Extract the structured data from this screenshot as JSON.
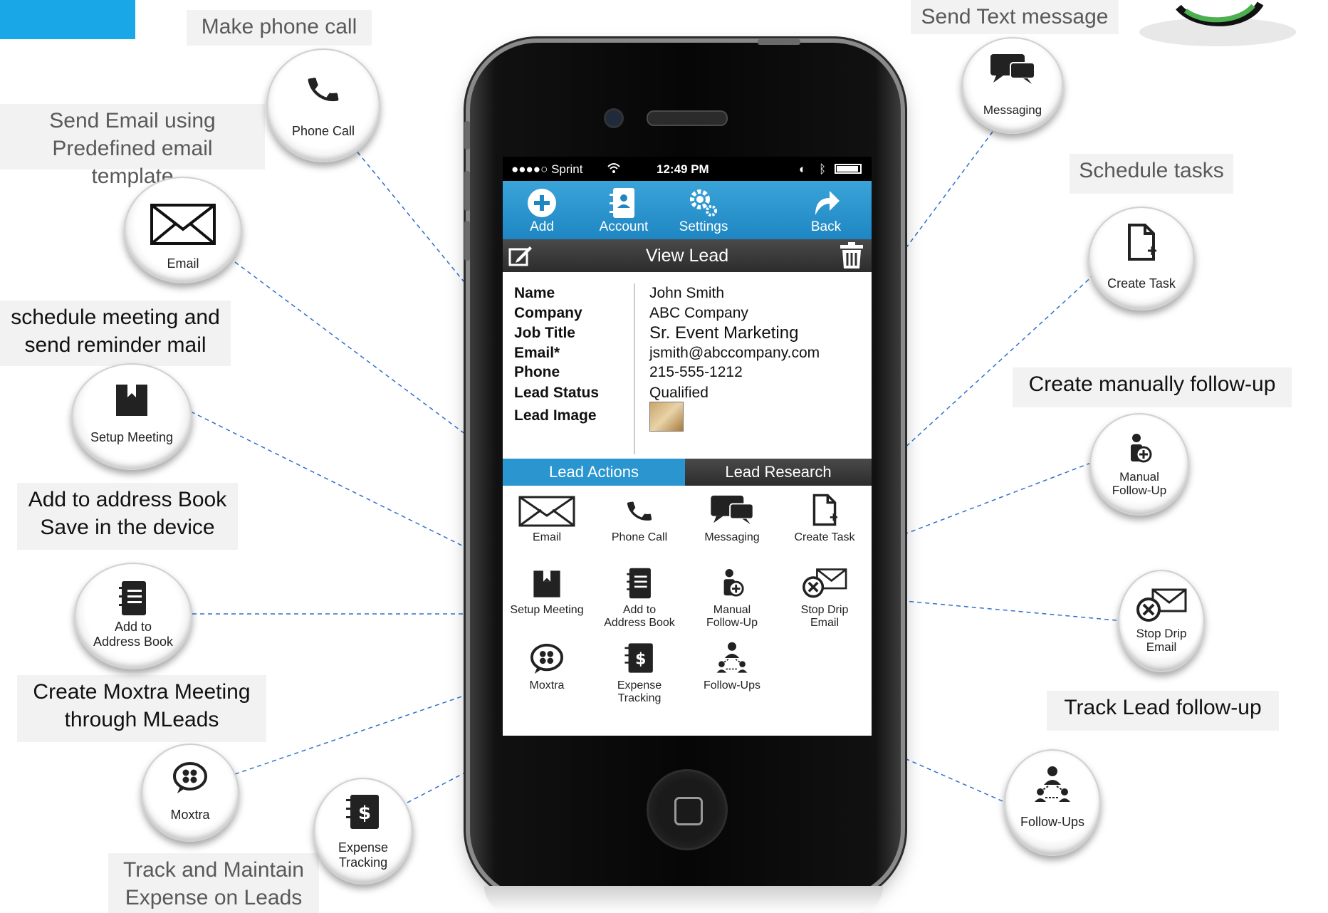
{
  "callouts": {
    "phone_call": "Make phone call",
    "send_email": "Send Email using\nPredefined email template",
    "schedule_meeting": "schedule meeting and\nsend reminder mail",
    "address_book": "Add to address Book\nSave in the device",
    "moxtra_meeting": "Create Moxtra Meeting\nthrough MLeads",
    "expense": "Track and Maintain\nExpense on Leads",
    "text_message": "Send Text message",
    "schedule_tasks": "Schedule tasks",
    "manual_followup": "Create manually follow-up",
    "track_followup": "Track  Lead follow-up"
  },
  "bubbles": {
    "phone_call": "Phone Call",
    "email": "Email",
    "setup_meeting": "Setup Meeting",
    "address_book": "Add to\nAddress Book",
    "moxtra": "Moxtra",
    "expense": "Expense\nTracking",
    "messaging": "Messaging",
    "create_task": "Create Task",
    "manual_followup": "Manual\nFollow-Up",
    "stop_drip": "Stop Drip\nEmail",
    "followups": "Follow-Ups"
  },
  "phone": {
    "status": {
      "carrier": "●●●●○ Sprint",
      "time": "12:49 PM"
    },
    "toolbar": [
      "Add",
      "Account",
      "Settings",
      "Back"
    ],
    "title": "View Lead",
    "details": [
      {
        "label": "Name",
        "value": "John Smith"
      },
      {
        "label": "Company",
        "value": "ABC Company"
      },
      {
        "label": "Job Title",
        "value": "Sr. Event Marketing"
      },
      {
        "label": "Email*",
        "value": "jsmith@abccompany.com"
      },
      {
        "label": "Phone",
        "value": "215-555-1212"
      },
      {
        "label": "Lead Status",
        "value": "Qualified"
      },
      {
        "label": "Lead Image",
        "value": ""
      }
    ],
    "tabs": {
      "actions": "Lead Actions",
      "research": "Lead Research"
    },
    "actions": [
      "Email",
      "Phone Call",
      "Messaging",
      "Create Task",
      "Setup Meeting",
      "Add to\nAddress Book",
      "Manual\nFollow-Up",
      "Stop Drip\nEmail",
      "Moxtra",
      "Expense\nTracking",
      "Follow-Ups"
    ]
  },
  "colors": {
    "accent": "#19a7e8",
    "toolbar": "#2a95cf",
    "tab_active": "#2a95cf",
    "tab_inactive": "#3a3a3a",
    "line": "#2f6fcf"
  }
}
